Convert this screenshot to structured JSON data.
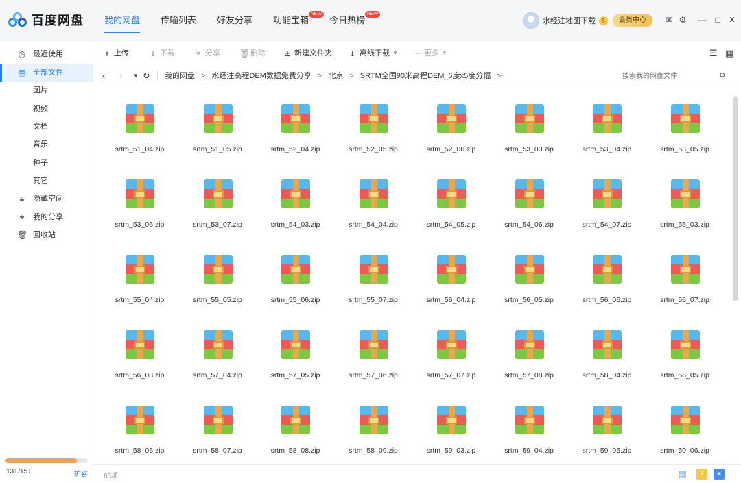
{
  "app": {
    "name": "百度网盘"
  },
  "nav": {
    "tabs": [
      {
        "label": "我的网盘",
        "active": true,
        "badge": ""
      },
      {
        "label": "传输列表",
        "active": false,
        "badge": ""
      },
      {
        "label": "好友分享",
        "active": false,
        "badge": ""
      },
      {
        "label": "功能宝箱",
        "active": false,
        "badge": "NEW"
      },
      {
        "label": "今日热榜",
        "active": false,
        "badge": "NEW"
      }
    ]
  },
  "user": {
    "name": "水经注地图下载",
    "level": "5",
    "vip_button": "会员中心"
  },
  "window_controls": [
    "✉",
    "⚙",
    "—",
    "□",
    "✕"
  ],
  "sidebar": {
    "items": [
      {
        "label": "最近使用",
        "icon": "clock-icon",
        "glyph": "◷"
      },
      {
        "label": "全部文件",
        "icon": "file-icon",
        "glyph": "▤",
        "active": true
      },
      {
        "label": "图片",
        "icon": "",
        "glyph": ""
      },
      {
        "label": "视频",
        "icon": "",
        "glyph": ""
      },
      {
        "label": "文档",
        "icon": "",
        "glyph": ""
      },
      {
        "label": "音乐",
        "icon": "",
        "glyph": ""
      },
      {
        "label": "种子",
        "icon": "",
        "glyph": ""
      },
      {
        "label": "其它",
        "icon": "",
        "glyph": ""
      },
      {
        "label": "隐藏空间",
        "icon": "lock-icon",
        "glyph": "🔒︎"
      },
      {
        "label": "我的分享",
        "icon": "share-icon",
        "glyph": "⚭"
      },
      {
        "label": "回收站",
        "icon": "trash-icon",
        "glyph": "🗑︎"
      }
    ],
    "storage": {
      "text": "13T/15T",
      "used_fraction": 0.87,
      "expand": "扩容"
    }
  },
  "toolbar": {
    "upload": "上传",
    "download": "下载",
    "share": "分享",
    "delete": "删除",
    "new_folder": "新建文件夹",
    "offline_download": "离线下载",
    "more": "更多"
  },
  "path": {
    "crumbs": [
      "我的网盘",
      "水经注高程DEM数据免费分享",
      "北京",
      "SRTM全国90米高程DEM_5度x5度分幅"
    ],
    "search_placeholder": "搜索我的网盘文件"
  },
  "files": [
    "srtm_51_04.zip",
    "srtm_51_05.zip",
    "srtm_52_04.zip",
    "srtm_52_05.zip",
    "srtm_52_06.zip",
    "srtm_53_03.zip",
    "srtm_53_04.zip",
    "srtm_53_05.zip",
    "srtm_53_06.zip",
    "srtm_53_07.zip",
    "srtm_54_03.zip",
    "srtm_54_04.zip",
    "srtm_54_05.zip",
    "srtm_54_06.zip",
    "srtm_54_07.zip",
    "srtm_55_03.zip",
    "srtm_55_04.zip",
    "srtm_55_05.zip",
    "srtm_55_06.zip",
    "srtm_55_07.zip",
    "srtm_56_04.zip",
    "srtm_56_05.zip",
    "srtm_56_06.zip",
    "srtm_56_07.zip",
    "srtm_56_08.zip",
    "srtm_57_04.zip",
    "srtm_57_05.zip",
    "srtm_57_06.zip",
    "srtm_57_07.zip",
    "srtm_57_08.zip",
    "srtm_58_04.zip",
    "srtm_58_05.zip",
    "srtm_58_06.zip",
    "srtm_58_07.zip",
    "srtm_58_08.zip",
    "srtm_58_09.zip",
    "srtm_59_03.zip",
    "srtm_59_04.zip",
    "srtm_59_05.zip",
    "srtm_59_06.zip"
  ],
  "status": {
    "count": "65项"
  },
  "colors": {
    "accent": "#2e7cf6",
    "storage": "#f7a24a",
    "badge": "#f5483b"
  }
}
